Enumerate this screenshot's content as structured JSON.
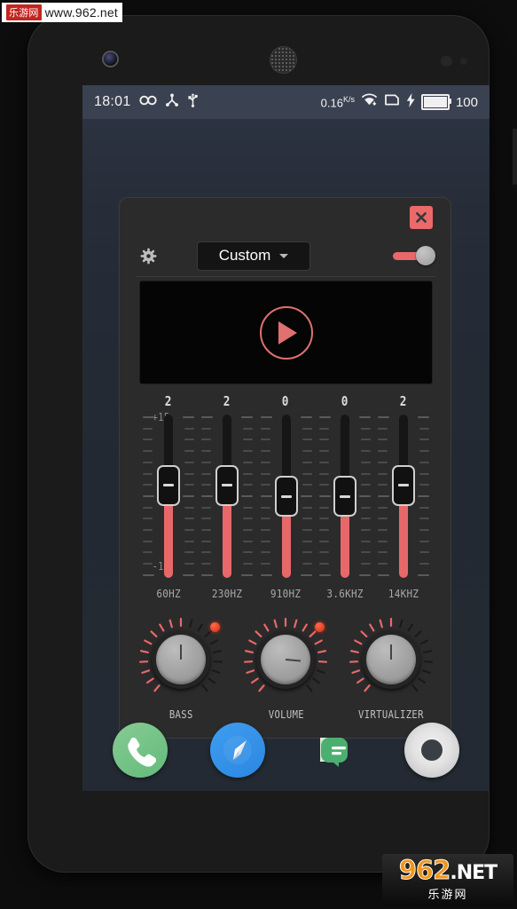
{
  "watermarks": {
    "top_cn": "乐游网",
    "top_url": "www.962.net",
    "bottom_brand": "962",
    "bottom_tld": ".NET",
    "bottom_cn": "乐游网"
  },
  "status_bar": {
    "clock": "18:01",
    "icons_left": [
      "infinity-icon",
      "share-icon",
      "usb-icon"
    ],
    "net_speed_value": "0.16",
    "net_speed_unit_top": "K",
    "net_speed_unit_bottom": "s",
    "wifi_icon": "wifi-download-icon",
    "sim_icon": "sim-card-icon",
    "charging_icon": "lightning-bolt-icon",
    "battery_icon": "battery-full-icon",
    "battery_percent": "100"
  },
  "equalizer": {
    "close_label": "X",
    "settings_icon": "gear-icon",
    "preset": "Custom",
    "preset_caret": "chevron-down-icon",
    "power_toggle_state": "on",
    "visualizer": {
      "play_icon": "play-triangle-icon",
      "accent": "#e07070"
    },
    "scale": {
      "max": "+15",
      "mid": "0",
      "min": "-15"
    },
    "bands": [
      {
        "value": "2",
        "freq": "60HZ",
        "gain": 2
      },
      {
        "value": "2",
        "freq": "230HZ",
        "gain": 2
      },
      {
        "value": "0",
        "freq": "910HZ",
        "gain": 0
      },
      {
        "value": "0",
        "freq": "3.6KHZ",
        "gain": 0
      },
      {
        "value": "2",
        "freq": "14KHZ",
        "gain": 2
      }
    ],
    "knobs": [
      {
        "label": "BASS",
        "angle": 0,
        "led": true
      },
      {
        "label": "VOLUME",
        "angle": 95,
        "led": true
      },
      {
        "label": "VIRTUALIZER",
        "angle": 0,
        "led": false
      }
    ],
    "colors": {
      "accent": "#e8686a",
      "panel": "#2b2b2b",
      "screen_bg": "#262c38"
    }
  },
  "dock": [
    {
      "name": "phone",
      "icon": "phone-icon",
      "color": "#63bb7a"
    },
    {
      "name": "browser",
      "icon": "compass-icon",
      "color": "#2b86e0"
    },
    {
      "name": "messages",
      "icon": "message-icon",
      "color": "#4caf70"
    },
    {
      "name": "camera",
      "icon": "camera-icon",
      "color": "#e2e2e2"
    }
  ]
}
